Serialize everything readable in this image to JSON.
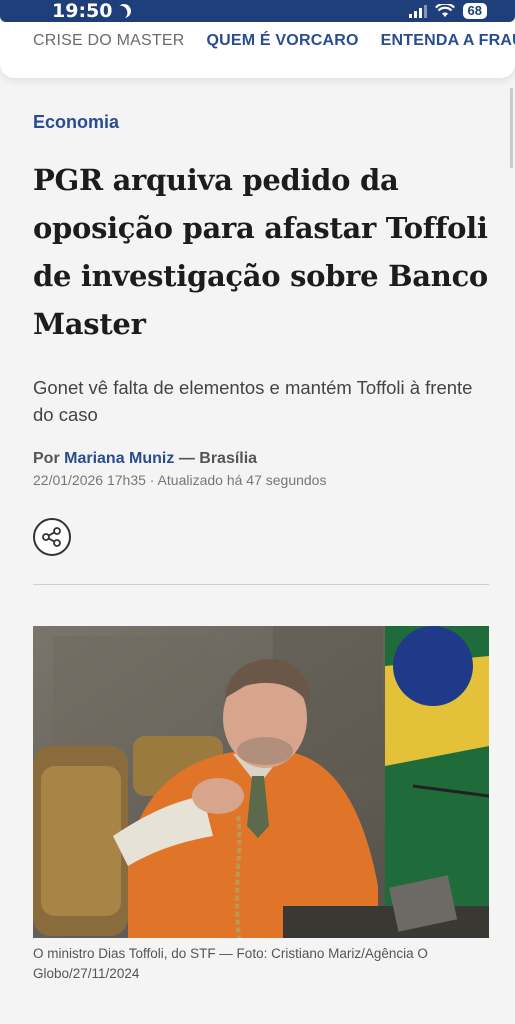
{
  "status_bar": {
    "time": "19:50",
    "battery": "68"
  },
  "nav": {
    "items": [
      {
        "label": "CRISE DO MASTER",
        "muted": true
      },
      {
        "label": "QUEM É VORCARO",
        "muted": false
      },
      {
        "label": "ENTENDA A FRAU",
        "muted": false
      }
    ]
  },
  "article": {
    "section": "Economia",
    "headline": "PGR arquiva pedido da oposição para afastar Toffoli de investigação sobre Banco Master",
    "subtitle": "Gonet vê falta de elementos e mantém Toffoli à frente do caso",
    "byline": {
      "prefix": "Por",
      "author": "Mariana Muniz",
      "location": "— Brasília"
    },
    "dateline": "22/01/2026 17h35 · Atualizado há 47 segundos",
    "caption": "O ministro Dias Toffoli, do STF — Foto: Cristiano Mariz/Agência O Globo/27/11/2024"
  },
  "colors": {
    "accent": "#2a4d8f",
    "status_bar": "#1f3f7a"
  },
  "icons": {
    "share": "share-icon",
    "moon": "moon-icon",
    "wifi": "wifi-icon",
    "signal": "signal-icon"
  }
}
